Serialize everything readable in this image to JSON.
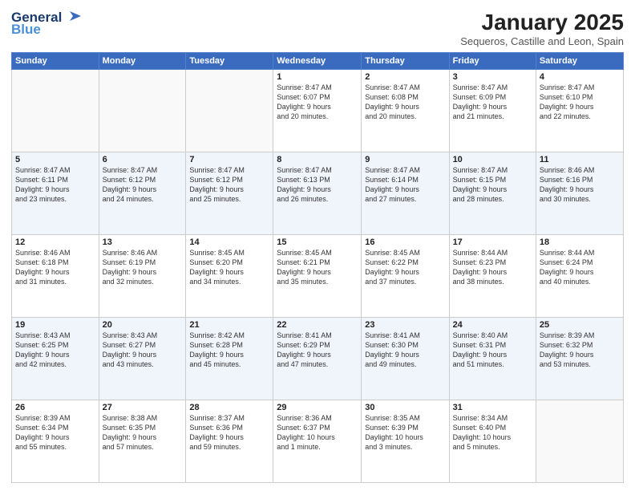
{
  "logo": {
    "line1": "General",
    "line2": "Blue"
  },
  "header": {
    "title": "January 2025",
    "location": "Sequeros, Castille and Leon, Spain"
  },
  "weekdays": [
    "Sunday",
    "Monday",
    "Tuesday",
    "Wednesday",
    "Thursday",
    "Friday",
    "Saturday"
  ],
  "weeks": [
    [
      {
        "day": "",
        "info": ""
      },
      {
        "day": "",
        "info": ""
      },
      {
        "day": "",
        "info": ""
      },
      {
        "day": "1",
        "info": "Sunrise: 8:47 AM\nSunset: 6:07 PM\nDaylight: 9 hours\nand 20 minutes."
      },
      {
        "day": "2",
        "info": "Sunrise: 8:47 AM\nSunset: 6:08 PM\nDaylight: 9 hours\nand 20 minutes."
      },
      {
        "day": "3",
        "info": "Sunrise: 8:47 AM\nSunset: 6:09 PM\nDaylight: 9 hours\nand 21 minutes."
      },
      {
        "day": "4",
        "info": "Sunrise: 8:47 AM\nSunset: 6:10 PM\nDaylight: 9 hours\nand 22 minutes."
      }
    ],
    [
      {
        "day": "5",
        "info": "Sunrise: 8:47 AM\nSunset: 6:11 PM\nDaylight: 9 hours\nand 23 minutes."
      },
      {
        "day": "6",
        "info": "Sunrise: 8:47 AM\nSunset: 6:12 PM\nDaylight: 9 hours\nand 24 minutes."
      },
      {
        "day": "7",
        "info": "Sunrise: 8:47 AM\nSunset: 6:12 PM\nDaylight: 9 hours\nand 25 minutes."
      },
      {
        "day": "8",
        "info": "Sunrise: 8:47 AM\nSunset: 6:13 PM\nDaylight: 9 hours\nand 26 minutes."
      },
      {
        "day": "9",
        "info": "Sunrise: 8:47 AM\nSunset: 6:14 PM\nDaylight: 9 hours\nand 27 minutes."
      },
      {
        "day": "10",
        "info": "Sunrise: 8:47 AM\nSunset: 6:15 PM\nDaylight: 9 hours\nand 28 minutes."
      },
      {
        "day": "11",
        "info": "Sunrise: 8:46 AM\nSunset: 6:16 PM\nDaylight: 9 hours\nand 30 minutes."
      }
    ],
    [
      {
        "day": "12",
        "info": "Sunrise: 8:46 AM\nSunset: 6:18 PM\nDaylight: 9 hours\nand 31 minutes."
      },
      {
        "day": "13",
        "info": "Sunrise: 8:46 AM\nSunset: 6:19 PM\nDaylight: 9 hours\nand 32 minutes."
      },
      {
        "day": "14",
        "info": "Sunrise: 8:45 AM\nSunset: 6:20 PM\nDaylight: 9 hours\nand 34 minutes."
      },
      {
        "day": "15",
        "info": "Sunrise: 8:45 AM\nSunset: 6:21 PM\nDaylight: 9 hours\nand 35 minutes."
      },
      {
        "day": "16",
        "info": "Sunrise: 8:45 AM\nSunset: 6:22 PM\nDaylight: 9 hours\nand 37 minutes."
      },
      {
        "day": "17",
        "info": "Sunrise: 8:44 AM\nSunset: 6:23 PM\nDaylight: 9 hours\nand 38 minutes."
      },
      {
        "day": "18",
        "info": "Sunrise: 8:44 AM\nSunset: 6:24 PM\nDaylight: 9 hours\nand 40 minutes."
      }
    ],
    [
      {
        "day": "19",
        "info": "Sunrise: 8:43 AM\nSunset: 6:25 PM\nDaylight: 9 hours\nand 42 minutes."
      },
      {
        "day": "20",
        "info": "Sunrise: 8:43 AM\nSunset: 6:27 PM\nDaylight: 9 hours\nand 43 minutes."
      },
      {
        "day": "21",
        "info": "Sunrise: 8:42 AM\nSunset: 6:28 PM\nDaylight: 9 hours\nand 45 minutes."
      },
      {
        "day": "22",
        "info": "Sunrise: 8:41 AM\nSunset: 6:29 PM\nDaylight: 9 hours\nand 47 minutes."
      },
      {
        "day": "23",
        "info": "Sunrise: 8:41 AM\nSunset: 6:30 PM\nDaylight: 9 hours\nand 49 minutes."
      },
      {
        "day": "24",
        "info": "Sunrise: 8:40 AM\nSunset: 6:31 PM\nDaylight: 9 hours\nand 51 minutes."
      },
      {
        "day": "25",
        "info": "Sunrise: 8:39 AM\nSunset: 6:32 PM\nDaylight: 9 hours\nand 53 minutes."
      }
    ],
    [
      {
        "day": "26",
        "info": "Sunrise: 8:39 AM\nSunset: 6:34 PM\nDaylight: 9 hours\nand 55 minutes."
      },
      {
        "day": "27",
        "info": "Sunrise: 8:38 AM\nSunset: 6:35 PM\nDaylight: 9 hours\nand 57 minutes."
      },
      {
        "day": "28",
        "info": "Sunrise: 8:37 AM\nSunset: 6:36 PM\nDaylight: 9 hours\nand 59 minutes."
      },
      {
        "day": "29",
        "info": "Sunrise: 8:36 AM\nSunset: 6:37 PM\nDaylight: 10 hours\nand 1 minute."
      },
      {
        "day": "30",
        "info": "Sunrise: 8:35 AM\nSunset: 6:39 PM\nDaylight: 10 hours\nand 3 minutes."
      },
      {
        "day": "31",
        "info": "Sunrise: 8:34 AM\nSunset: 6:40 PM\nDaylight: 10 hours\nand 5 minutes."
      },
      {
        "day": "",
        "info": ""
      }
    ]
  ]
}
